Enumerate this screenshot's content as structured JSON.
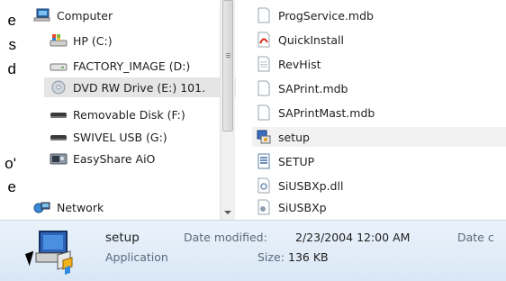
{
  "doc_fragment": {
    "lines": [
      "e",
      "s",
      "d",
      "o'",
      "e"
    ]
  },
  "nav": {
    "items": [
      {
        "label": "Computer",
        "icon": "computer-icon"
      },
      {
        "label": "HP (C:)",
        "icon": "hard-drive-windows-icon"
      },
      {
        "label": "FACTORY_IMAGE (D:)",
        "icon": "hard-drive-icon"
      },
      {
        "label": "DVD RW Drive (E:) 101.",
        "icon": "dvd-drive-icon"
      },
      {
        "label": "Removable Disk (F:)",
        "icon": "removable-disk-icon"
      },
      {
        "label": "SWIVEL USB (G:)",
        "icon": "usb-drive-icon"
      },
      {
        "label": "EasyShare AiO",
        "icon": "camera-device-icon"
      },
      {
        "label": "Network",
        "icon": "network-icon"
      }
    ]
  },
  "files": [
    {
      "name": "ProgService.mdb",
      "icon": "document-icon"
    },
    {
      "name": "QuickInstall",
      "icon": "pdf-icon"
    },
    {
      "name": "RevHist",
      "icon": "text-file-icon"
    },
    {
      "name": "SAPrint.mdb",
      "icon": "document-icon"
    },
    {
      "name": "SAPrintMast.mdb",
      "icon": "document-icon"
    },
    {
      "name": "setup",
      "icon": "setup-installer-icon"
    },
    {
      "name": "SETUP",
      "icon": "settings-file-icon"
    },
    {
      "name": "SiUSBXp.dll",
      "icon": "dll-file-icon"
    },
    {
      "name": "SiUSBXp",
      "icon": "setup-info-icon"
    }
  ],
  "details": {
    "name": "setup",
    "type": "Application",
    "date_modified_label": "Date modified:",
    "date_modified_value": "2/23/2004 12:00 AM",
    "size_label": "Size:",
    "size_value": "136 KB",
    "date_created_label": "Date c"
  }
}
